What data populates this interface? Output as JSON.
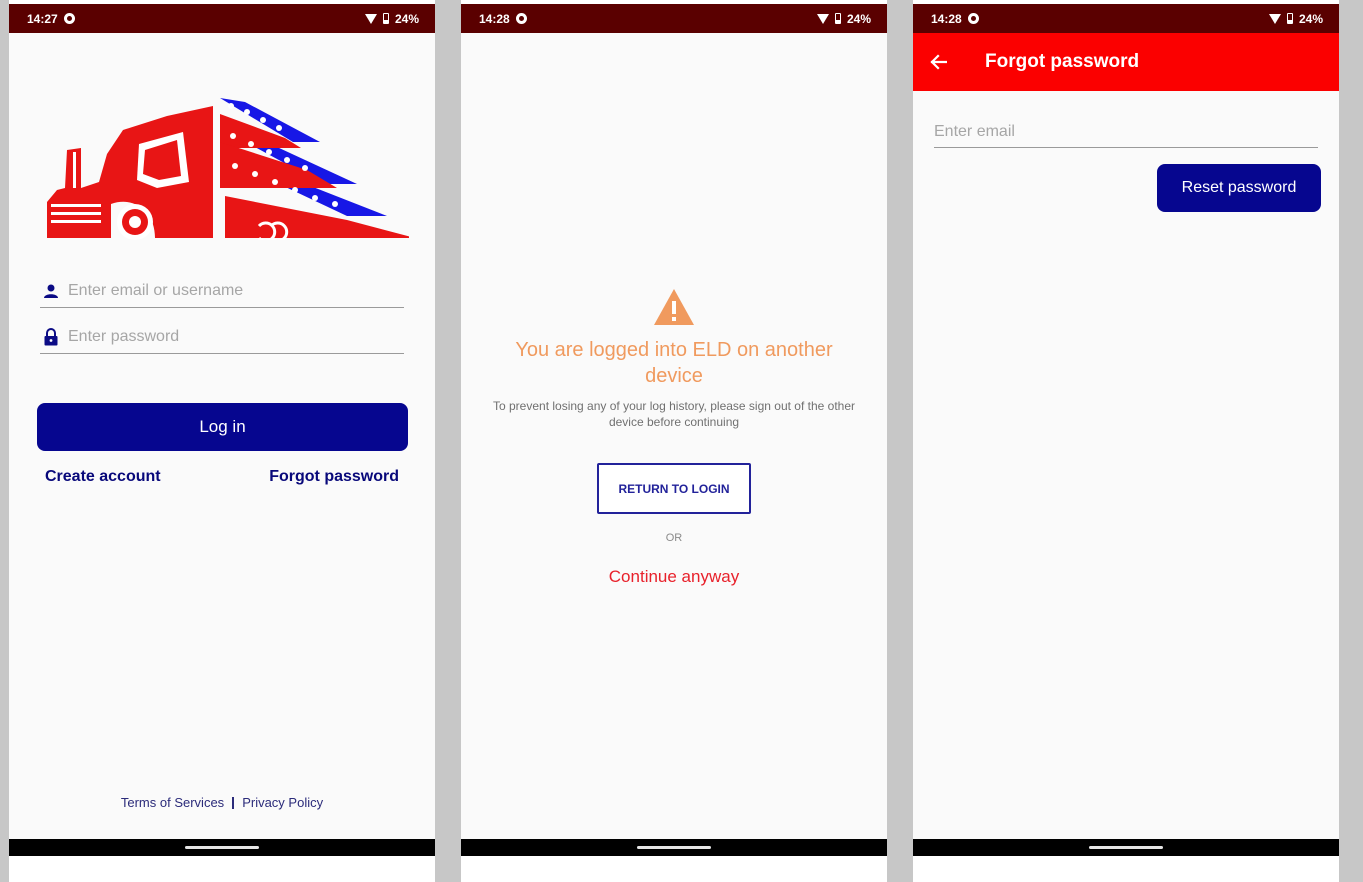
{
  "screens": [
    {
      "status_time": "14:27",
      "battery": "24%"
    },
    {
      "status_time": "14:28",
      "battery": "24%"
    },
    {
      "status_time": "14:28",
      "battery": "24%"
    }
  ],
  "login": {
    "email_placeholder": "Enter email or username",
    "password_placeholder": "Enter password",
    "login_label": "Log in",
    "create_account_label": "Create account",
    "forgot_password_label": "Forgot password",
    "terms_label": "Terms of Services",
    "privacy_label": "Privacy Policy"
  },
  "another_device": {
    "title": "You are logged into ELD on another device",
    "description": "To prevent losing any of your log history, please sign out of the other device before continuing",
    "return_label": "RETURN TO LOGIN",
    "or_label": "OR",
    "continue_label": "Continue anyway"
  },
  "forgot": {
    "title": "Forgot password",
    "email_placeholder": "Enter email",
    "reset_label": "Reset password"
  },
  "colors": {
    "status_bar": "#5a0000",
    "primary_blue": "#06068f",
    "app_bar_red": "#fb0000",
    "warning_orange": "#f09a5e",
    "continue_red": "#e8212b"
  },
  "icons": [
    "user-icon",
    "lock-icon",
    "warning-icon",
    "back-arrow-icon",
    "wifi-icon",
    "battery-icon",
    "logo-truck-flag"
  ]
}
